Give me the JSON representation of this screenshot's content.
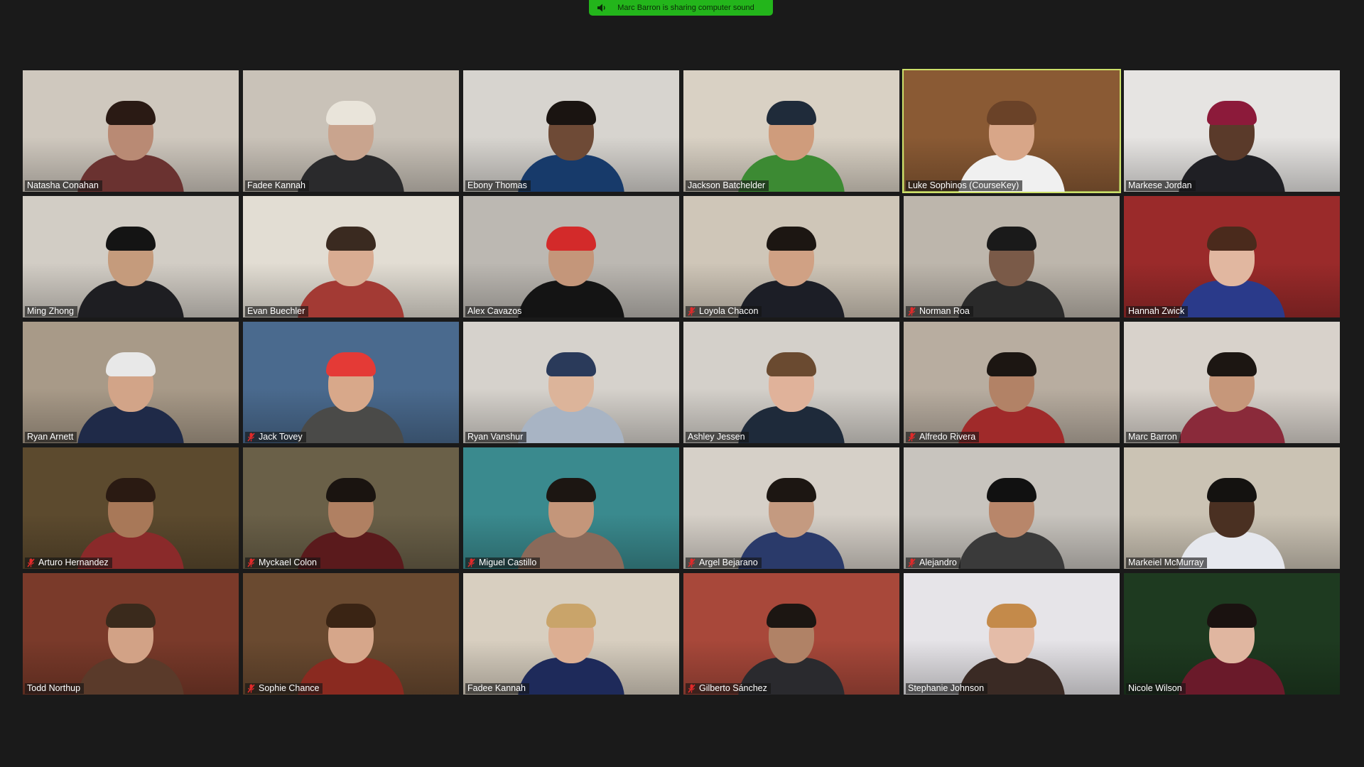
{
  "banner": {
    "text": "Marc Barron is sharing computer sound",
    "icon": "speaker-icon",
    "color": "#23b51b"
  },
  "active_speaker_color": "#cde06a",
  "participants": [
    {
      "name": "Natasha Conahan",
      "muted": false,
      "active": false,
      "bg": "#cfc8be",
      "skin": "#b98a74",
      "shirt": "#6a3230",
      "hair": "#2a1a14"
    },
    {
      "name": "Fadee Kannah",
      "muted": false,
      "active": false,
      "bg": "#c9c2b8",
      "skin": "#c9a48e",
      "shirt": "#2a2a2c",
      "hair": "#e9e4da"
    },
    {
      "name": "Ebony Thomas",
      "muted": false,
      "active": false,
      "bg": "#d7d4cf",
      "skin": "#6e4a36",
      "shirt": "#173a6a",
      "hair": "#1a1411"
    },
    {
      "name": "Jackson Batchelder",
      "muted": false,
      "active": false,
      "bg": "#d9d1c4",
      "skin": "#cf9c7c",
      "shirt": "#3c8a33",
      "hair": "#1f2b3a"
    },
    {
      "name": "Luke Sophinos (CourseKey)",
      "muted": false,
      "active": true,
      "bg": "#8a5a34",
      "skin": "#d8a688",
      "shirt": "#f0f0f0",
      "hair": "#6a4228"
    },
    {
      "name": "Markese Jordan",
      "muted": false,
      "active": false,
      "bg": "#e6e4e2",
      "skin": "#5a3a2a",
      "shirt": "#1f1f24",
      "hair": "#8c1a3a"
    },
    {
      "name": "Ming Zhong",
      "muted": false,
      "active": false,
      "bg": "#d2cdc5",
      "skin": "#c59b7c",
      "shirt": "#1e1e22",
      "hair": "#141414"
    },
    {
      "name": "Evan Buechler",
      "muted": false,
      "active": false,
      "bg": "#e2ddd3",
      "skin": "#d9ac92",
      "shirt": "#a33a34",
      "hair": "#3a2a20"
    },
    {
      "name": "Alex Cavazos",
      "muted": false,
      "active": false,
      "bg": "#bcb8b2",
      "skin": "#c4967a",
      "shirt": "#141414",
      "hair": "#d32a2a"
    },
    {
      "name": "Loyola Chacon",
      "muted": true,
      "active": false,
      "bg": "#cfc6b8",
      "skin": "#d0a184",
      "shirt": "#1c1e26",
      "hair": "#1c1612"
    },
    {
      "name": "Norman Roa",
      "muted": true,
      "active": false,
      "bg": "#bdb6ac",
      "skin": "#7a5a48",
      "shirt": "#2a2a2a",
      "hair": "#1a1a1a"
    },
    {
      "name": "Hannah Zwick",
      "muted": false,
      "active": false,
      "bg": "#9a2a2a",
      "skin": "#e1b7a0",
      "shirt": "#2a3a8a",
      "hair": "#4a2a1c"
    },
    {
      "name": "Ryan Arnett",
      "muted": false,
      "active": false,
      "bg": "#a89a88",
      "skin": "#d2a488",
      "shirt": "#1f2a48",
      "hair": "#e8e8e8"
    },
    {
      "name": "Jack Tovey",
      "muted": true,
      "active": false,
      "bg": "#4a6a8e",
      "skin": "#d8a88a",
      "shirt": "#4a4a48",
      "hair": "#e43a36"
    },
    {
      "name": "Ryan Vanshur",
      "muted": false,
      "active": false,
      "bg": "#d6d2cc",
      "skin": "#dcb49a",
      "shirt": "#a8b4c4",
      "hair": "#2a3a5a"
    },
    {
      "name": "Ashley Jessen",
      "muted": false,
      "active": false,
      "bg": "#d4d0ca",
      "skin": "#e0b29a",
      "shirt": "#1e2a3a",
      "hair": "#6a4a30"
    },
    {
      "name": "Alfredo Rivera",
      "muted": true,
      "active": false,
      "bg": "#b8ada0",
      "skin": "#b28266",
      "shirt": "#a02a2a",
      "hair": "#1c1612"
    },
    {
      "name": "Marc Barron",
      "muted": false,
      "active": false,
      "bg": "#d8d2cb",
      "skin": "#c6977a",
      "shirt": "#8a2a3a",
      "hair": "#1c1612"
    },
    {
      "name": "Arturo Hernandez",
      "muted": true,
      "active": false,
      "bg": "#5c4a2e",
      "skin": "#a87858",
      "shirt": "#8a2a2a",
      "hair": "#2a1a12"
    },
    {
      "name": "Myckael Colon",
      "muted": true,
      "active": false,
      "bg": "#6a6048",
      "skin": "#b08062",
      "shirt": "#5a1a1c",
      "hair": "#1a1410"
    },
    {
      "name": "Miguel Castillo",
      "muted": true,
      "active": false,
      "bg": "#3a8a8e",
      "skin": "#c4967a",
      "shirt": "#8a6a5a",
      "hair": "#1c1612"
    },
    {
      "name": "Argel Bejarano",
      "muted": true,
      "active": false,
      "bg": "#d6d0c8",
      "skin": "#c49a80",
      "shirt": "#2a3a6a",
      "hair": "#1c1612"
    },
    {
      "name": "Alejandro",
      "muted": true,
      "active": false,
      "bg": "#c8c4be",
      "skin": "#b8866a",
      "shirt": "#3a3a3a",
      "hair": "#111111"
    },
    {
      "name": "Markeiel McMurray",
      "muted": false,
      "active": false,
      "bg": "#cbc3b4",
      "skin": "#4a3022",
      "shirt": "#e6e8ee",
      "hair": "#141210"
    },
    {
      "name": "Todd Northup",
      "muted": false,
      "active": false,
      "bg": "#7a3a2a",
      "skin": "#d2a286",
      "shirt": "#5a3a2a",
      "hair": "#3a2a1c"
    },
    {
      "name": "Sophie Chance",
      "muted": true,
      "active": false,
      "bg": "#6a4a30",
      "skin": "#d6a68a",
      "shirt": "#8a2a20",
      "hair": "#3a2414"
    },
    {
      "name": "Fadee Kannah",
      "muted": false,
      "active": false,
      "bg": "#d8cfc0",
      "skin": "#dcae92",
      "shirt": "#1e2a5a",
      "hair": "#c9a46a"
    },
    {
      "name": "Gilberto Sánchez",
      "muted": true,
      "active": false,
      "bg": "#a8483a",
      "skin": "#b08266",
      "shirt": "#2a2a2e",
      "hair": "#1c1612"
    },
    {
      "name": "Stephanie Johnson",
      "muted": false,
      "active": false,
      "bg": "#e6e4e8",
      "skin": "#e4bca8",
      "shirt": "#3a2a24",
      "hair": "#c48a4a"
    },
    {
      "name": "Nicole Wilson",
      "muted": false,
      "active": false,
      "bg": "#1e3a20",
      "skin": "#e0b6a0",
      "shirt": "#6a1a2a",
      "hair": "#1a1210"
    }
  ]
}
